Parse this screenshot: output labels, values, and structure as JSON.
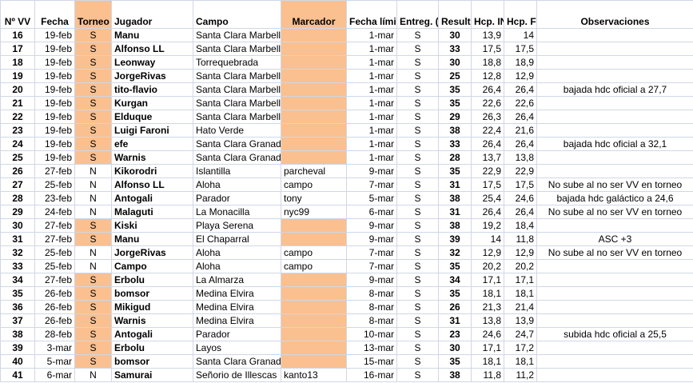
{
  "colors": {
    "highlight": "#fac090",
    "gridline": "#d0d7e5"
  },
  "headers": {
    "num": "Nº VV",
    "fecha": "Fecha",
    "torneo": "Torneo (S/N)",
    "jugador": "Jugador",
    "campo": "Campo",
    "marcador": "Marcador",
    "fecha_limite": "Fecha límite",
    "entreg": "Entreg. (S/N)",
    "result": "Result.",
    "hcp_ini": "Hcp. INI",
    "hcp_fin": "Hcp. FIN",
    "obs": "Observaciones"
  },
  "rows": [
    {
      "num": "16",
      "fecha": "19-feb",
      "torneo": "S",
      "jugador": "Manu",
      "campo": "Santa Clara Marbella",
      "marcador": "",
      "limite": "1-mar",
      "entreg": "S",
      "result": "30",
      "ini": "13,9",
      "fin": "14",
      "obs": ""
    },
    {
      "num": "17",
      "fecha": "19-feb",
      "torneo": "S",
      "jugador": "Alfonso LL",
      "campo": "Santa Clara Marbella",
      "marcador": "",
      "limite": "1-mar",
      "entreg": "S",
      "result": "33",
      "ini": "17,5",
      "fin": "17,5",
      "obs": ""
    },
    {
      "num": "18",
      "fecha": "19-feb",
      "torneo": "S",
      "jugador": "Leonway",
      "campo": "Torrequebrada",
      "marcador": "",
      "limite": "1-mar",
      "entreg": "S",
      "result": "30",
      "ini": "18,8",
      "fin": "18,9",
      "obs": ""
    },
    {
      "num": "19",
      "fecha": "19-feb",
      "torneo": "S",
      "jugador": "JorgeRivas",
      "campo": "Santa Clara Marbella",
      "marcador": "",
      "limite": "1-mar",
      "entreg": "S",
      "result": "25",
      "ini": "12,8",
      "fin": "12,9",
      "obs": ""
    },
    {
      "num": "20",
      "fecha": "19-feb",
      "torneo": "S",
      "jugador": "tito-flavio",
      "campo": "Santa Clara Marbella",
      "marcador": "",
      "limite": "1-mar",
      "entreg": "S",
      "result": "35",
      "ini": "26,4",
      "fin": "26,4",
      "obs": "bajada hdc oficial a 27,7"
    },
    {
      "num": "21",
      "fecha": "19-feb",
      "torneo": "S",
      "jugador": "Kurgan",
      "campo": "Santa Clara Marbella",
      "marcador": "",
      "limite": "1-mar",
      "entreg": "S",
      "result": "35",
      "ini": "22,6",
      "fin": "22,6",
      "obs": ""
    },
    {
      "num": "22",
      "fecha": "19-feb",
      "torneo": "S",
      "jugador": "Elduque",
      "campo": "Santa Clara Marbella",
      "marcador": "",
      "limite": "1-mar",
      "entreg": "S",
      "result": "29",
      "ini": "26,3",
      "fin": "26,4",
      "obs": ""
    },
    {
      "num": "23",
      "fecha": "19-feb",
      "torneo": "S",
      "jugador": "Luigi Faroni",
      "campo": "Hato Verde",
      "marcador": "",
      "limite": "1-mar",
      "entreg": "S",
      "result": "38",
      "ini": "22,4",
      "fin": "21,6",
      "obs": ""
    },
    {
      "num": "24",
      "fecha": "19-feb",
      "torneo": "S",
      "jugador": "efe",
      "campo": "Santa Clara Granada",
      "marcador": "",
      "limite": "1-mar",
      "entreg": "S",
      "result": "33",
      "ini": "26,4",
      "fin": "26,4",
      "obs": "bajada hdc oficial a 32,1"
    },
    {
      "num": "25",
      "fecha": "19-feb",
      "torneo": "S",
      "jugador": "Warnis",
      "campo": "Santa Clara Granada",
      "marcador": "",
      "limite": "1-mar",
      "entreg": "S",
      "result": "28",
      "ini": "13,7",
      "fin": "13,8",
      "obs": ""
    },
    {
      "num": "26",
      "fecha": "27-feb",
      "torneo": "N",
      "jugador": "Kikorodri",
      "campo": "Islantilla",
      "marcador": "parcheval",
      "limite": "9-mar",
      "entreg": "S",
      "result": "35",
      "ini": "22,9",
      "fin": "22,9",
      "obs": ""
    },
    {
      "num": "27",
      "fecha": "25-feb",
      "torneo": "N",
      "jugador": "Alfonso LL",
      "campo": "Aloha",
      "marcador": "campo",
      "limite": "7-mar",
      "entreg": "S",
      "result": "31",
      "ini": "17,5",
      "fin": "17,5",
      "obs": "No sube al no ser VV en torneo"
    },
    {
      "num": "28",
      "fecha": "23-feb",
      "torneo": "N",
      "jugador": "Antogali",
      "campo": "Parador",
      "marcador": "tony",
      "limite": "5-mar",
      "entreg": "S",
      "result": "38",
      "ini": "25,4",
      "fin": "24,6",
      "obs": "bajada hdc galáctico a 24,6"
    },
    {
      "num": "29",
      "fecha": "24-feb",
      "torneo": "N",
      "jugador": "Malaguti",
      "campo": "La Monacilla",
      "marcador": "nyc99",
      "limite": "6-mar",
      "entreg": "S",
      "result": "31",
      "ini": "26,4",
      "fin": "26,4",
      "obs": "No sube al no ser VV en torneo"
    },
    {
      "num": "30",
      "fecha": "27-feb",
      "torneo": "S",
      "jugador": "Kiski",
      "campo": "Playa Serena",
      "marcador": "",
      "limite": "9-mar",
      "entreg": "S",
      "result": "38",
      "ini": "19,2",
      "fin": "18,4",
      "obs": ""
    },
    {
      "num": "31",
      "fecha": "27-feb",
      "torneo": "S",
      "jugador": "Manu",
      "campo": "El Chaparral",
      "marcador": "",
      "limite": "9-mar",
      "entreg": "S",
      "result": "39",
      "ini": "14",
      "fin": "11,8",
      "obs": "ASC +3"
    },
    {
      "num": "32",
      "fecha": "25-feb",
      "torneo": "N",
      "jugador": "JorgeRivas",
      "campo": "Aloha",
      "marcador": "campo",
      "limite": "7-mar",
      "entreg": "S",
      "result": "32",
      "ini": "12,9",
      "fin": "12,9",
      "obs": "No sube al no ser VV en torneo"
    },
    {
      "num": "33",
      "fecha": "25-feb",
      "torneo": "N",
      "jugador": "Campo",
      "campo": "Aloha",
      "marcador": "campo",
      "limite": "7-mar",
      "entreg": "S",
      "result": "35",
      "ini": "20,2",
      "fin": "20,2",
      "obs": ""
    },
    {
      "num": "34",
      "fecha": "27-feb",
      "torneo": "S",
      "jugador": "Erbolu",
      "campo": "La Almarza",
      "marcador": "",
      "limite": "9-mar",
      "entreg": "S",
      "result": "34",
      "ini": "17,1",
      "fin": "17,1",
      "obs": ""
    },
    {
      "num": "35",
      "fecha": "26-feb",
      "torneo": "S",
      "jugador": "bomsor",
      "campo": "Medina Elvira",
      "marcador": "",
      "limite": "8-mar",
      "entreg": "S",
      "result": "35",
      "ini": "18,1",
      "fin": "18,1",
      "obs": ""
    },
    {
      "num": "36",
      "fecha": "26-feb",
      "torneo": "S",
      "jugador": "Mikigud",
      "campo": "Medina Elvira",
      "marcador": "",
      "limite": "8-mar",
      "entreg": "S",
      "result": "26",
      "ini": "21,3",
      "fin": "21,4",
      "obs": ""
    },
    {
      "num": "37",
      "fecha": "26-feb",
      "torneo": "S",
      "jugador": "Warnis",
      "campo": "Medina Elvira",
      "marcador": "",
      "limite": "8-mar",
      "entreg": "S",
      "result": "31",
      "ini": "13,8",
      "fin": "13,9",
      "obs": ""
    },
    {
      "num": "38",
      "fecha": "28-feb",
      "torneo": "S",
      "jugador": "Antogali",
      "campo": "Parador",
      "marcador": "",
      "limite": "10-mar",
      "entreg": "S",
      "result": "23",
      "ini": "24,6",
      "fin": "24,7",
      "obs": "subida hdc oficial a 25,5"
    },
    {
      "num": "39",
      "fecha": "3-mar",
      "torneo": "S",
      "jugador": "Erbolu",
      "campo": "Layos",
      "marcador": "",
      "limite": "13-mar",
      "entreg": "S",
      "result": "30",
      "ini": "17,1",
      "fin": "17,2",
      "obs": ""
    },
    {
      "num": "40",
      "fecha": "5-mar",
      "torneo": "S",
      "jugador": "bomsor",
      "campo": "Santa Clara Granada",
      "marcador": "",
      "limite": "15-mar",
      "entreg": "S",
      "result": "35",
      "ini": "18,1",
      "fin": "18,1",
      "obs": ""
    },
    {
      "num": "41",
      "fecha": "6-mar",
      "torneo": "N",
      "jugador": "Samurai",
      "campo": "Señorio de Illescas",
      "marcador": "kanto13",
      "limite": "16-mar",
      "entreg": "S",
      "result": "38",
      "ini": "11,8",
      "fin": "11,2",
      "obs": ""
    }
  ]
}
